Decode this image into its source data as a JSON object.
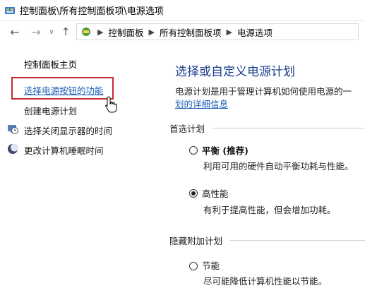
{
  "window": {
    "title": "控制面板\\所有控制面板项\\电源选项"
  },
  "nav": {
    "breadcrumb": [
      "控制面板",
      "所有控制面板项",
      "电源选项"
    ]
  },
  "sidebar": {
    "home": "控制面板主页",
    "items": [
      {
        "label": "选择电源按钮的功能",
        "icon": "none"
      },
      {
        "label": "创建电源计划",
        "icon": "none"
      },
      {
        "label": "选择关闭显示器的时间",
        "icon": "monitor-clock-icon"
      },
      {
        "label": "更改计算机睡眠时间",
        "icon": "moon-icon"
      }
    ]
  },
  "main": {
    "heading": "选择或自定义电源计划",
    "description": "电源计划是用于管理计算机如何使用电源的一",
    "details_link": "划的详细信息",
    "preferred_title": "首选计划",
    "hidden_title": "隐藏附加计划",
    "plans": [
      {
        "name": "平衡 (推荐)",
        "description": "利用可用的硬件自动平衡功耗与性能。",
        "selected": false
      },
      {
        "name": "高性能",
        "description": "有利于提高性能，但会增加功耗。",
        "selected": true
      },
      {
        "name": "节能",
        "description": "尽可能降低计算机性能以节能。",
        "selected": false
      }
    ]
  },
  "colors": {
    "link": "#1b5fb8",
    "heading": "#1c3e8e",
    "highlight": "#c8282f"
  }
}
